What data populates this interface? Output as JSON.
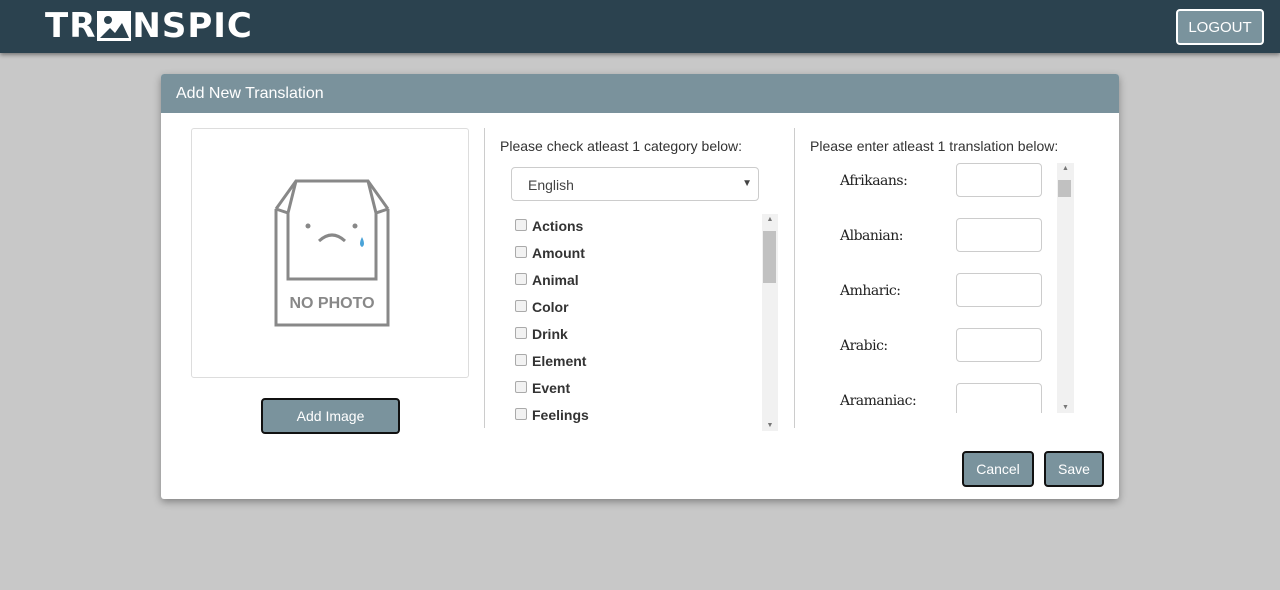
{
  "nav": {
    "logo": "TRANSPIC",
    "logo_parts": [
      "TR",
      "NSPIC"
    ],
    "logout": "LOGOUT"
  },
  "modal": {
    "title": "Add New Translation",
    "image": {
      "placeholder_text": "NO PHOTO",
      "add_image": "Add Image"
    },
    "categories": {
      "prompt": "Please check atleast 1 category below:",
      "language": "English",
      "items": [
        "Actions",
        "Amount",
        "Animal",
        "Color",
        "Drink",
        "Element",
        "Event",
        "Feelings"
      ]
    },
    "translations": {
      "prompt": "Please enter atleast 1 translation below:",
      "languages": [
        "Afrikaans:",
        "Albanian:",
        "Amharic:",
        "Arabic:",
        "Aramaniac:"
      ]
    },
    "cancel": "Cancel",
    "save": "Save"
  },
  "colors": {
    "navbar": "#2b424f",
    "header": "#7a929c",
    "button": "#7a939d"
  }
}
